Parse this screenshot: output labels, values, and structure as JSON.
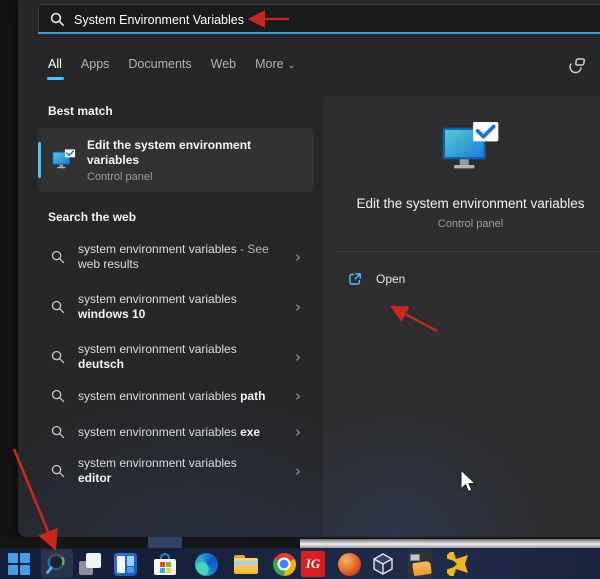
{
  "colors": {
    "accent": "#4cc2ff",
    "search_underline": "#35a3dd",
    "annotation_red": "#c8281c",
    "taskbar_bg": "#16203a",
    "panel_bg": "#272729"
  },
  "search_bar": {
    "value": "System Environment Variables",
    "icon": "search-icon"
  },
  "filter_tabs": {
    "items": [
      {
        "label": "All",
        "active": true
      },
      {
        "label": "Apps",
        "active": false
      },
      {
        "label": "Documents",
        "active": false
      },
      {
        "label": "Web",
        "active": false
      },
      {
        "label": "More",
        "active": false,
        "has_chevron": true
      }
    ]
  },
  "glyphs": {
    "chevron_right": "›",
    "more_chevron": "⌄"
  },
  "left_panel": {
    "best_match": {
      "header": "Best match",
      "item": {
        "title": "Edit the system environment variables",
        "subtitle": "Control panel",
        "icon": "system-properties-monitor-check-icon"
      }
    },
    "web_search": {
      "header": "Search the web",
      "items": [
        {
          "l1_reg": "system environment variables",
          "l1_dim": "- See",
          "l2_reg": "web results",
          "l2_bold": "",
          "l1_bold": ""
        },
        {
          "l1_reg": "system environment variables",
          "l1_dim": "",
          "l2_reg": "",
          "l2_bold": "windows 10",
          "l1_bold": ""
        },
        {
          "l1_reg": "system environment variables",
          "l1_dim": "",
          "l2_reg": "",
          "l2_bold": "deutsch",
          "l1_bold": ""
        },
        {
          "l1_reg": "system environment variables",
          "l1_dim": "",
          "l2_reg": "",
          "l2_bold": "",
          "l1_bold": "path"
        },
        {
          "l1_reg": "system environment variables",
          "l1_dim": "",
          "l2_reg": "",
          "l2_bold": "",
          "l1_bold": "exe"
        },
        {
          "l1_reg": "system environment variables",
          "l1_dim": "",
          "l2_reg": "",
          "l2_bold": "editor",
          "l1_bold": ""
        }
      ]
    }
  },
  "right_panel": {
    "title": "Edit the system environment variables",
    "subtitle": "Control panel",
    "icon": "system-properties-monitor-check-icon",
    "actions": {
      "open_label": "Open",
      "open_icon": "open-external-icon"
    }
  },
  "taskbar": {
    "icons": [
      "windows-start",
      "taskbar-search",
      "task-view",
      "widgets",
      "microsoft-store",
      "edge-browser",
      "file-explorer",
      "chrome-browser",
      "ig-app",
      "orange-globe-app",
      "cube-app",
      "folder-utility-app",
      "yellow-arrows-app"
    ]
  },
  "annotations": {
    "arrow_color": "#c8281c",
    "arrows": [
      "arrow-to-search-box",
      "arrow-to-open-button",
      "arrow-to-taskbar-search"
    ],
    "cursor": "mouse-pointer"
  }
}
